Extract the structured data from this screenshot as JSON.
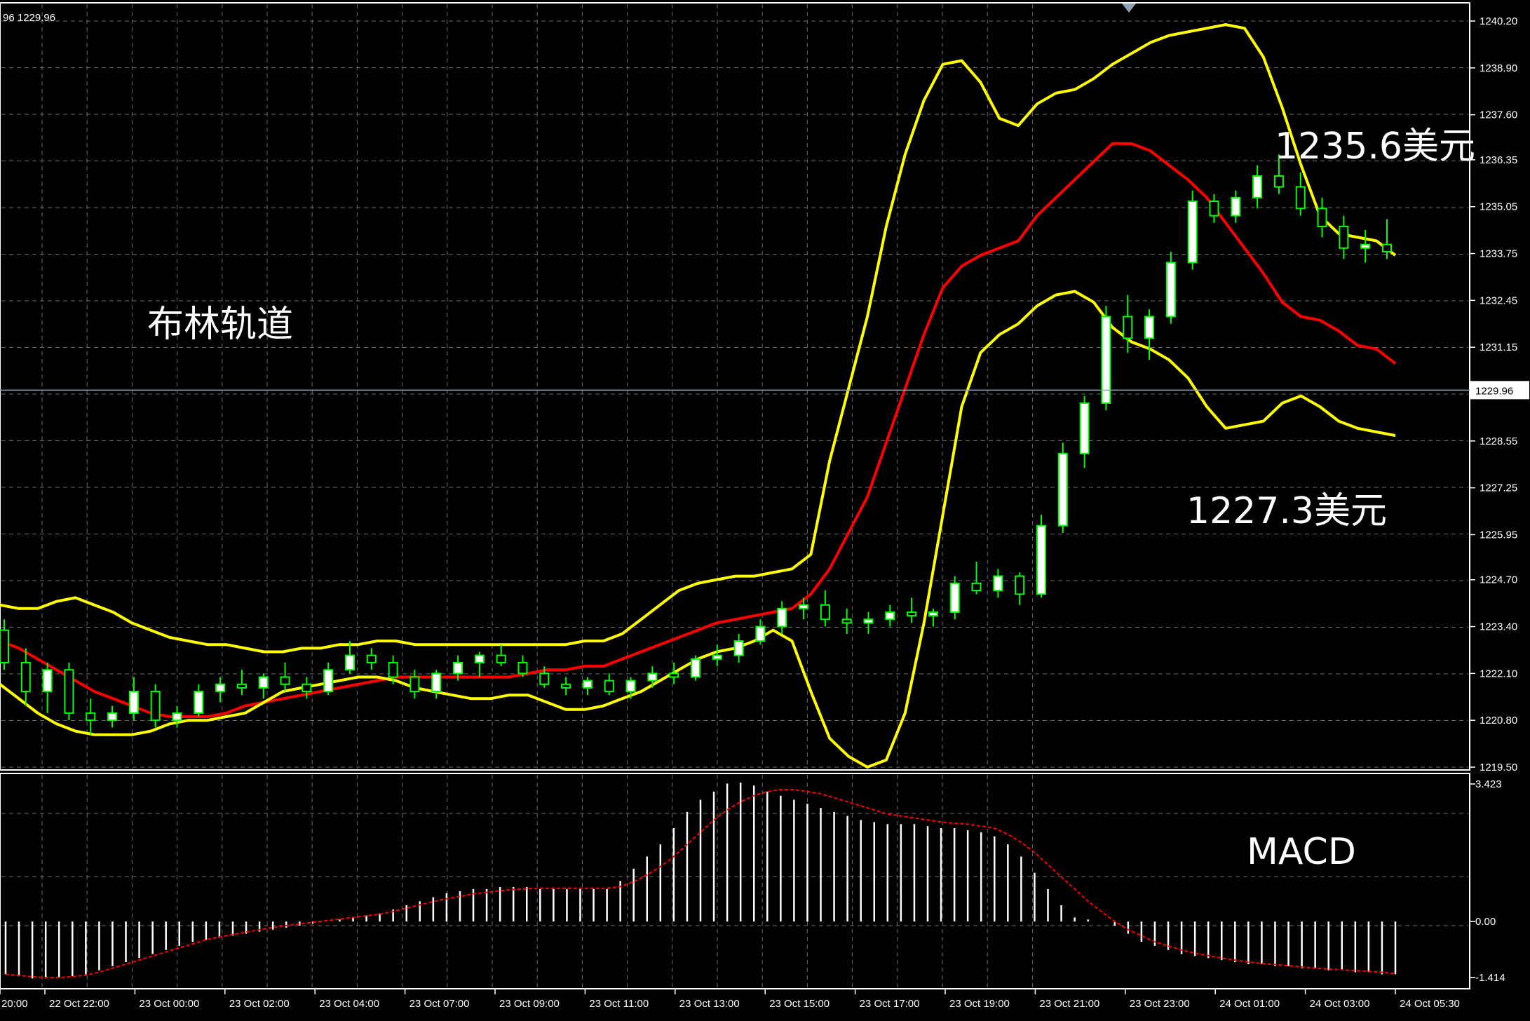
{
  "chart_data": [
    {
      "type": "candlestick",
      "title": "",
      "header_readout": "96 1229.96",
      "current_price": 1229.96,
      "current_price_label": "1229.96",
      "y_ticks": [
        "1240.20",
        "1238.90",
        "1237.60",
        "1236.35",
        "1235.05",
        "1233.75",
        "1232.45",
        "1231.15",
        "1229.96",
        "1228.55",
        "1227.25",
        "1225.95",
        "1224.70",
        "1223.40",
        "1222.10",
        "1220.80",
        "1219.50"
      ],
      "ylim": [
        1219.5,
        1240.2
      ],
      "x_ticks": [
        "20:00",
        "22 Oct 22:00",
        "23 Oct 00:00",
        "23 Oct 02:00",
        "23 Oct 04:00",
        "23 Oct 07:00",
        "23 Oct 09:00",
        "23 Oct 11:00",
        "23 Oct 13:00",
        "23 Oct 15:00",
        "23 Oct 17:00",
        "23 Oct 19:00",
        "23 Oct 21:00",
        "23 Oct 23:00",
        "24 Oct 01:00",
        "24 Oct 03:00",
        "24 Oct 05:30"
      ],
      "indicator": "Bollinger Bands",
      "annotations": [
        {
          "text": "布林轨道"
        },
        {
          "text": "1235.6美元"
        },
        {
          "text": "1227.3美元"
        }
      ],
      "colors": {
        "candle_up": "#ffffff",
        "candle_down": "#00ff00",
        "wick": "#00ff00",
        "band": "#ffff00",
        "middle_band": "#ff0000",
        "grid": "#6b6b6b",
        "price_line": "#7a8aa0"
      },
      "grid": true,
      "series": [
        {
          "name": "upper_band",
          "values": [
            1224.0,
            1223.9,
            1223.9,
            1224.1,
            1224.2,
            1224.0,
            1223.8,
            1223.5,
            1223.3,
            1223.1,
            1223.0,
            1222.9,
            1222.9,
            1222.8,
            1222.7,
            1222.7,
            1222.8,
            1222.8,
            1222.9,
            1222.9,
            1223.0,
            1223.0,
            1222.9,
            1222.9,
            1222.9,
            1222.9,
            1222.9,
            1222.9,
            1222.9,
            1222.9,
            1222.9,
            1223.0,
            1223.0,
            1223.2,
            1223.6,
            1224.0,
            1224.4,
            1224.6,
            1224.7,
            1224.8,
            1224.8,
            1224.9,
            1225.0,
            1225.4,
            1228.0,
            1230.0,
            1232.0,
            1234.5,
            1236.5,
            1238.0,
            1239.0,
            1239.1,
            1238.5,
            1237.5,
            1237.3,
            1237.9,
            1238.2,
            1238.3,
            1238.6,
            1239.0,
            1239.3,
            1239.6,
            1239.8,
            1239.9,
            1240.0,
            1240.1,
            1240.0,
            1239.2,
            1237.8,
            1236.2,
            1234.8,
            1234.3,
            1234.2,
            1234.1,
            1233.7
          ]
        },
        {
          "name": "middle_band",
          "values": [
            1223.0,
            1222.8,
            1222.5,
            1222.2,
            1221.9,
            1221.6,
            1221.4,
            1221.2,
            1221.0,
            1220.9,
            1220.9,
            1220.9,
            1221.0,
            1221.2,
            1221.3,
            1221.4,
            1221.5,
            1221.6,
            1221.7,
            1221.8,
            1221.9,
            1222.0,
            1222.0,
            1222.0,
            1222.0,
            1222.0,
            1222.0,
            1222.0,
            1222.1,
            1222.2,
            1222.2,
            1222.3,
            1222.3,
            1222.5,
            1222.7,
            1222.9,
            1223.1,
            1223.3,
            1223.5,
            1223.6,
            1223.7,
            1223.8,
            1223.9,
            1224.3,
            1225.0,
            1226.0,
            1227.0,
            1228.5,
            1230.0,
            1231.5,
            1232.8,
            1233.4,
            1233.7,
            1233.9,
            1234.1,
            1234.8,
            1235.3,
            1235.8,
            1236.3,
            1236.8,
            1236.8,
            1236.6,
            1236.2,
            1235.8,
            1235.3,
            1234.6,
            1233.9,
            1233.2,
            1232.4,
            1232.0,
            1231.9,
            1231.6,
            1231.2,
            1231.1,
            1230.7
          ]
        },
        {
          "name": "lower_band",
          "values": [
            1221.8,
            1221.4,
            1221.0,
            1220.7,
            1220.5,
            1220.4,
            1220.4,
            1220.4,
            1220.5,
            1220.7,
            1220.8,
            1220.8,
            1220.9,
            1221.0,
            1221.3,
            1221.6,
            1221.7,
            1221.8,
            1221.9,
            1222.0,
            1222.0,
            1221.9,
            1221.7,
            1221.6,
            1221.5,
            1221.4,
            1221.4,
            1221.5,
            1221.5,
            1221.3,
            1221.1,
            1221.1,
            1221.2,
            1221.4,
            1221.6,
            1221.9,
            1222.2,
            1222.5,
            1222.7,
            1222.8,
            1223.0,
            1223.3,
            1223.0,
            1221.6,
            1220.3,
            1219.8,
            1219.5,
            1219.7,
            1221.0,
            1223.5,
            1226.5,
            1229.5,
            1231.0,
            1231.5,
            1231.8,
            1232.3,
            1232.6,
            1232.7,
            1232.4,
            1231.7,
            1231.3,
            1231.1,
            1230.8,
            1230.3,
            1229.5,
            1228.9,
            1229.0,
            1229.1,
            1229.6,
            1229.8,
            1229.5,
            1229.1,
            1228.9,
            1228.8,
            1228.7
          ]
        },
        {
          "name": "candles",
          "ohlc": [
            [
              1223.3,
              1223.6,
              1222.2,
              1222.4
            ],
            [
              1222.4,
              1222.8,
              1221.2,
              1221.6
            ],
            [
              1221.6,
              1222.4,
              1221.0,
              1222.2
            ],
            [
              1222.2,
              1222.4,
              1220.8,
              1221.0
            ],
            [
              1221.0,
              1221.4,
              1220.4,
              1220.8
            ],
            [
              1220.8,
              1221.2,
              1220.6,
              1221.0
            ],
            [
              1221.0,
              1222.0,
              1220.8,
              1221.6
            ],
            [
              1221.6,
              1221.8,
              1220.6,
              1220.8
            ],
            [
              1220.8,
              1221.2,
              1220.6,
              1221.0
            ],
            [
              1221.0,
              1221.8,
              1220.9,
              1221.6
            ],
            [
              1221.6,
              1222.0,
              1221.3,
              1221.8
            ],
            [
              1221.8,
              1222.2,
              1221.5,
              1221.7
            ],
            [
              1221.7,
              1222.1,
              1221.4,
              1222.0
            ],
            [
              1222.0,
              1222.4,
              1221.6,
              1221.8
            ],
            [
              1221.8,
              1222.0,
              1221.4,
              1221.6
            ],
            [
              1221.6,
              1222.4,
              1221.5,
              1222.2
            ],
            [
              1222.2,
              1223.0,
              1222.1,
              1222.6
            ],
            [
              1222.6,
              1222.8,
              1222.2,
              1222.4
            ],
            [
              1222.4,
              1222.6,
              1221.8,
              1222.0
            ],
            [
              1222.0,
              1222.2,
              1221.4,
              1221.6
            ],
            [
              1221.6,
              1222.2,
              1221.4,
              1222.1
            ],
            [
              1222.1,
              1222.6,
              1221.9,
              1222.4
            ],
            [
              1222.4,
              1222.7,
              1222.0,
              1222.6
            ],
            [
              1222.6,
              1222.9,
              1222.3,
              1222.4
            ],
            [
              1222.4,
              1222.6,
              1222.0,
              1222.1
            ],
            [
              1222.1,
              1222.3,
              1221.7,
              1221.8
            ],
            [
              1221.8,
              1222.0,
              1221.5,
              1221.7
            ],
            [
              1221.7,
              1222.0,
              1221.5,
              1221.9
            ],
            [
              1221.9,
              1222.1,
              1221.5,
              1221.6
            ],
            [
              1221.6,
              1222.0,
              1221.4,
              1221.9
            ],
            [
              1221.9,
              1222.3,
              1221.7,
              1222.1
            ],
            [
              1222.1,
              1222.4,
              1221.8,
              1222.0
            ],
            [
              1222.0,
              1222.6,
              1221.9,
              1222.5
            ],
            [
              1222.5,
              1222.9,
              1222.3,
              1222.6
            ],
            [
              1222.6,
              1223.2,
              1222.4,
              1223.0
            ],
            [
              1223.0,
              1223.6,
              1222.9,
              1223.4
            ],
            [
              1223.4,
              1224.1,
              1223.2,
              1223.9
            ],
            [
              1223.9,
              1224.2,
              1223.6,
              1224.0
            ],
            [
              1224.0,
              1224.4,
              1223.4,
              1223.6
            ],
            [
              1223.6,
              1223.9,
              1223.2,
              1223.5
            ],
            [
              1223.5,
              1223.8,
              1223.2,
              1223.6
            ],
            [
              1223.6,
              1224.0,
              1223.4,
              1223.8
            ],
            [
              1223.8,
              1224.2,
              1223.5,
              1223.7
            ],
            [
              1223.7,
              1223.9,
              1223.4,
              1223.8
            ],
            [
              1223.8,
              1224.8,
              1223.6,
              1224.6
            ],
            [
              1224.6,
              1225.2,
              1224.3,
              1224.4
            ],
            [
              1224.4,
              1225.0,
              1224.2,
              1224.8
            ],
            [
              1224.8,
              1224.9,
              1224.0,
              1224.3
            ],
            [
              1224.3,
              1226.5,
              1224.2,
              1226.2
            ],
            [
              1226.2,
              1228.5,
              1226.0,
              1228.2
            ],
            [
              1228.2,
              1229.8,
              1227.8,
              1229.6
            ],
            [
              1229.6,
              1232.3,
              1229.4,
              1232.0
            ],
            [
              1232.0,
              1232.6,
              1231.0,
              1231.4
            ],
            [
              1231.4,
              1232.2,
              1230.8,
              1232.0
            ],
            [
              1232.0,
              1233.8,
              1231.8,
              1233.5
            ],
            [
              1233.5,
              1235.5,
              1233.3,
              1235.2
            ],
            [
              1235.2,
              1235.4,
              1234.6,
              1234.8
            ],
            [
              1234.8,
              1235.5,
              1234.6,
              1235.3
            ],
            [
              1235.3,
              1236.2,
              1235.0,
              1235.9
            ],
            [
              1235.9,
              1236.5,
              1235.4,
              1235.6
            ],
            [
              1235.6,
              1236.0,
              1234.8,
              1235.0
            ],
            [
              1235.0,
              1235.3,
              1234.2,
              1234.5
            ],
            [
              1234.5,
              1234.8,
              1233.6,
              1233.9
            ],
            [
              1233.9,
              1234.4,
              1233.5,
              1234.0
            ],
            [
              1234.0,
              1234.7,
              1233.6,
              1233.8
            ]
          ]
        }
      ]
    },
    {
      "type": "bar",
      "title": "",
      "annotations": [
        {
          "text": "MACD"
        }
      ],
      "y_ticks": [
        "3.423",
        "0.00",
        "-1.414"
      ],
      "ylim": [
        -1.414,
        3.423
      ],
      "colors": {
        "histogram": "#ffffff",
        "signal": "#ff0000"
      },
      "series": [
        {
          "name": "histogram",
          "values": [
            -1.3,
            -1.35,
            -1.4,
            -1.4,
            -1.38,
            -1.35,
            -1.3,
            -1.2,
            -1.1,
            -1.0,
            -0.9,
            -0.8,
            -0.7,
            -0.6,
            -0.5,
            -0.45,
            -0.4,
            -0.35,
            -0.3,
            -0.25,
            -0.2,
            -0.15,
            -0.1,
            -0.05,
            0.0,
            0.05,
            0.1,
            0.15,
            0.2,
            0.3,
            0.4,
            0.5,
            0.6,
            0.7,
            0.75,
            0.8,
            0.8,
            0.85,
            0.85,
            0.85,
            0.8,
            0.8,
            0.8,
            0.8,
            0.8,
            0.8,
            1.0,
            1.3,
            1.6,
            1.9,
            2.3,
            2.7,
            3.0,
            3.2,
            3.4,
            3.42,
            3.35,
            3.2,
            3.1,
            3.0,
            2.9,
            2.8,
            2.7,
            2.6,
            2.5,
            2.45,
            2.4,
            2.4,
            2.4,
            2.35,
            2.3,
            2.3,
            2.25,
            2.2,
            2.1,
            1.9,
            1.6,
            1.2,
            0.8,
            0.4,
            0.1,
            0.05,
            0.0,
            -0.1,
            -0.3,
            -0.5,
            -0.6,
            -0.7,
            -0.8,
            -0.85,
            -0.9,
            -0.95,
            -1.0,
            -1.05,
            -1.05,
            -1.1,
            -1.1,
            -1.15,
            -1.15,
            -1.2,
            -1.2,
            -1.25,
            -1.25,
            -1.3,
            -1.3
          ]
        },
        {
          "name": "signal",
          "values": [
            -1.3,
            -1.33,
            -1.36,
            -1.38,
            -1.38,
            -1.36,
            -1.32,
            -1.25,
            -1.15,
            -1.05,
            -0.95,
            -0.85,
            -0.75,
            -0.65,
            -0.55,
            -0.45,
            -0.38,
            -0.32,
            -0.26,
            -0.2,
            -0.15,
            -0.1,
            -0.06,
            -0.02,
            0.02,
            0.06,
            0.1,
            0.14,
            0.18,
            0.25,
            0.33,
            0.41,
            0.49,
            0.56,
            0.62,
            0.68,
            0.72,
            0.76,
            0.79,
            0.81,
            0.82,
            0.82,
            0.82,
            0.82,
            0.82,
            0.82,
            0.86,
            0.98,
            1.15,
            1.35,
            1.6,
            1.9,
            2.2,
            2.5,
            2.75,
            2.95,
            3.1,
            3.2,
            3.25,
            3.25,
            3.2,
            3.15,
            3.05,
            2.95,
            2.85,
            2.75,
            2.65,
            2.6,
            2.55,
            2.5,
            2.45,
            2.42,
            2.4,
            2.35,
            2.3,
            2.15,
            1.95,
            1.7,
            1.4,
            1.1,
            0.8,
            0.5,
            0.25,
            0.0,
            -0.2,
            -0.35,
            -0.5,
            -0.6,
            -0.7,
            -0.78,
            -0.84,
            -0.9,
            -0.95,
            -1.0,
            -1.03,
            -1.06,
            -1.09,
            -1.12,
            -1.15,
            -1.17,
            -1.19,
            -1.21,
            -1.23,
            -1.25,
            -1.28
          ]
        }
      ]
    }
  ]
}
